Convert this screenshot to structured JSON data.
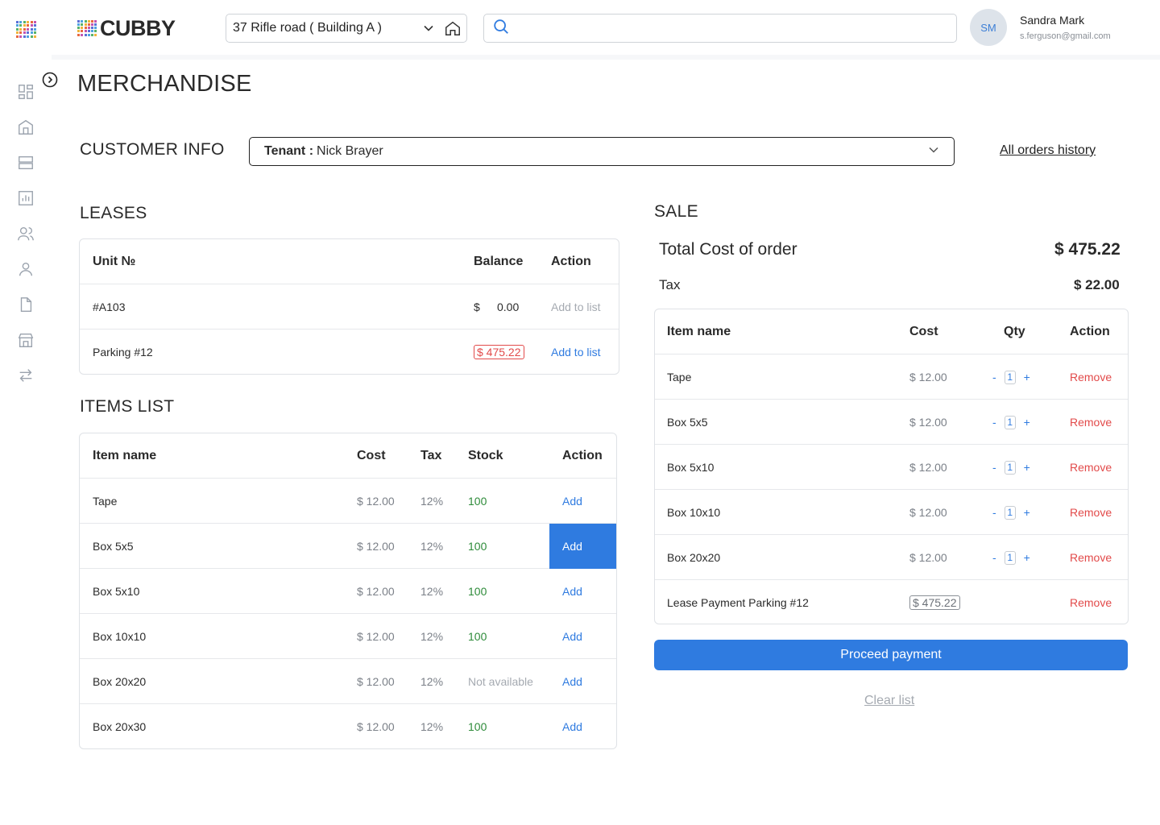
{
  "app": {
    "logo_text": "CUBBY"
  },
  "header": {
    "location": "37 Rifle road ( Building A )",
    "search_placeholder": "",
    "user": {
      "initials": "SM",
      "name": "Sandra Mark",
      "email": "s.ferguson@gmail.com"
    }
  },
  "sidebar_icons": [
    "dashboard-icon",
    "building-icon",
    "units-icon",
    "reports-icon",
    "tenants-icon",
    "user-icon",
    "document-icon",
    "store-icon",
    "transfer-icon"
  ],
  "page": {
    "title": "MERCHANDISE"
  },
  "customer": {
    "section_title": "CUSTOMER INFO",
    "tenant_label": "Tenant :",
    "tenant_value": "Nick Brayer",
    "orders_link": "All orders history"
  },
  "leases": {
    "section_title": "LEASES",
    "headers": {
      "unit": "Unit №",
      "balance": "Balance",
      "action": "Action"
    },
    "rows": [
      {
        "unit": "#A103",
        "currency": "$",
        "amount": "0.00",
        "action": "Add to list"
      },
      {
        "unit": "Parking #12",
        "balance": "$ 475.22",
        "action": "Add to list"
      }
    ]
  },
  "items": {
    "section_title": "ITEMS LIST",
    "headers": {
      "name": "Item name",
      "cost": "Cost",
      "tax": "Tax",
      "stock": "Stock",
      "action": "Action"
    },
    "rows": [
      {
        "name": "Tape",
        "cost": "$ 12.00",
        "tax": "12%",
        "stock": "100",
        "action": "Add"
      },
      {
        "name": "Box 5x5",
        "cost": "$ 12.00",
        "tax": "12%",
        "stock": "100",
        "action": "Add"
      },
      {
        "name": "Box 5x10",
        "cost": "$ 12.00",
        "tax": "12%",
        "stock": "100",
        "action": "Add"
      },
      {
        "name": "Box 10x10",
        "cost": "$ 12.00",
        "tax": "12%",
        "stock": "100",
        "action": "Add"
      },
      {
        "name": "Box 20x20",
        "cost": "$ 12.00",
        "tax": "12%",
        "stock": "Not available",
        "action": "Add"
      },
      {
        "name": "Box 20x30",
        "cost": "$ 12.00",
        "tax": "12%",
        "stock": "100",
        "action": "Add"
      }
    ]
  },
  "sale": {
    "section_title": "SALE",
    "total_label": "Total Cost of order",
    "total_value": "$ 475.22",
    "tax_label": "Tax",
    "tax_value": "$ 22.00",
    "headers": {
      "name": "Item name",
      "cost": "Cost",
      "qty": "Qty",
      "action": "Action"
    },
    "rows": [
      {
        "name": "Tape",
        "cost": "$ 12.00",
        "qty": "1",
        "minus": "-",
        "plus": "+",
        "action": "Remove"
      },
      {
        "name": "Box 5x5",
        "cost": "$ 12.00",
        "qty": "1",
        "minus": "-",
        "plus": "+",
        "action": "Remove"
      },
      {
        "name": "Box 5x10",
        "cost": "$ 12.00",
        "qty": "1",
        "minus": "-",
        "plus": "+",
        "action": "Remove"
      },
      {
        "name": "Box 10x10",
        "cost": "$ 12.00",
        "qty": "1",
        "minus": "-",
        "plus": "+",
        "action": "Remove"
      },
      {
        "name": "Box 20x20",
        "cost": "$ 12.00",
        "qty": "1",
        "minus": "-",
        "plus": "+",
        "action": "Remove"
      },
      {
        "name": "Lease Payment Parking #12",
        "cost": "$ 475.22",
        "action": "Remove"
      }
    ],
    "proceed_label": "Proceed payment",
    "clear_label": "Clear list"
  },
  "colors": {
    "accent": "#2f7be0",
    "danger": "#e24a4a",
    "success": "#2e8b3a"
  }
}
